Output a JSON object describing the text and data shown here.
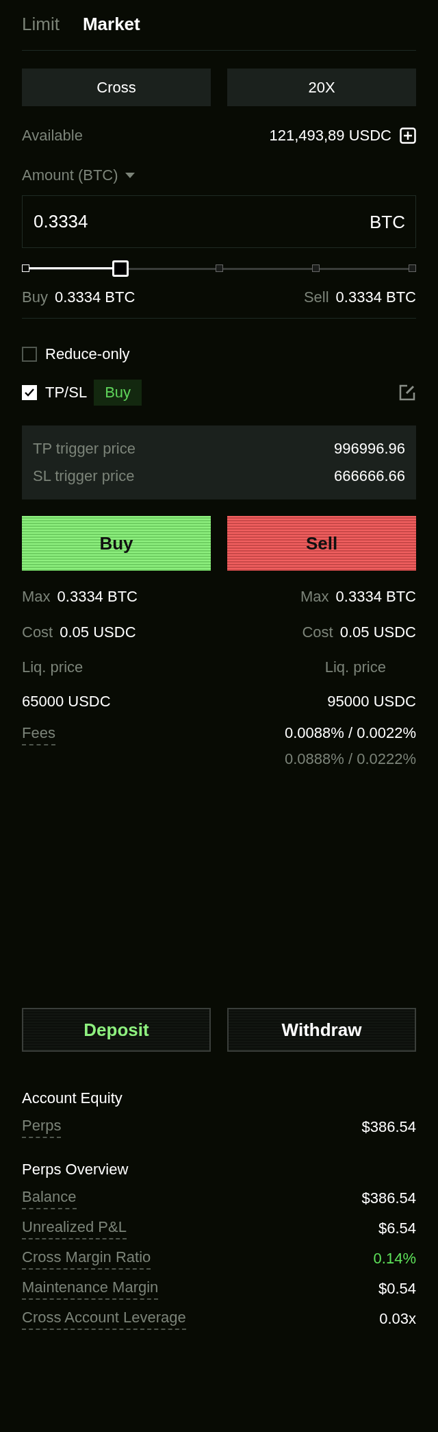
{
  "tabs": [
    {
      "label": "Limit",
      "selected": false
    },
    {
      "label": "Market",
      "selected": true
    }
  ],
  "mode_buttons": [
    "Cross",
    "20X"
  ],
  "available": {
    "label": "Available",
    "value": "121,493,89 USDC"
  },
  "amount": {
    "label": "Amount (BTC)",
    "value": "0.3334",
    "unit": "BTC"
  },
  "slider": {
    "level": 0.25
  },
  "size_summary": [
    {
      "label": "Buy",
      "value": "0.3334 BTC"
    },
    {
      "label": "Sell",
      "value": "0.3334 BTC"
    }
  ],
  "options": [
    {
      "label": "Reduce-only",
      "checked": false
    },
    {
      "label": "TP/SL",
      "checked": true,
      "badge": "Buy"
    }
  ],
  "triggers": [
    {
      "label": "TP trigger price",
      "value": "996996.96"
    },
    {
      "label": "SL trigger price",
      "value": "666666.66"
    }
  ],
  "actions": [
    {
      "label": "Buy",
      "kind": "buy"
    },
    {
      "label": "Sell",
      "kind": "sell"
    }
  ],
  "order_info": [
    {
      "left": {
        "label": "Max",
        "value": "0.3334 BTC"
      },
      "right": {
        "label": "Max",
        "value": "0.3334 BTC"
      }
    },
    {
      "left": {
        "label": "Cost",
        "value": "0.05 USDC"
      },
      "right": {
        "label": "Cost",
        "value": "0.05 USDC"
      }
    }
  ],
  "liquidation": {
    "left": {
      "label": "Liq. price",
      "value": "65000 USDC"
    },
    "right": {
      "label": "Liq. price",
      "value": "95000 USDC"
    }
  },
  "fees": {
    "label": "Fees",
    "values": [
      "0.0088% / 0.0022%",
      "0.0888% / 0.0222%"
    ]
  },
  "transfer_buttons": [
    {
      "label": "Deposit",
      "kind": "primary"
    },
    {
      "label": "Withdraw",
      "kind": "secondary"
    }
  ],
  "account_equity": {
    "title": "Account Equity",
    "rows": [
      {
        "label": "Perps",
        "value": "$386.54",
        "color": "#ffffff"
      }
    ]
  },
  "perps_overview": {
    "title": "Perps Overview",
    "rows": [
      {
        "label": "Balance",
        "value": "$386.54",
        "color": "#ffffff"
      },
      {
        "label": "Unrealized P&L",
        "value": "$6.54",
        "color": "#ffffff"
      },
      {
        "label": "Cross Margin Ratio",
        "value": "0.14%",
        "color": "#5ee25a"
      },
      {
        "label": "Maintenance Margin",
        "value": "$0.54",
        "color": "#ffffff"
      },
      {
        "label": "Cross Account Leverage",
        "value": "0.03x",
        "color": "#ffffff"
      }
    ]
  }
}
